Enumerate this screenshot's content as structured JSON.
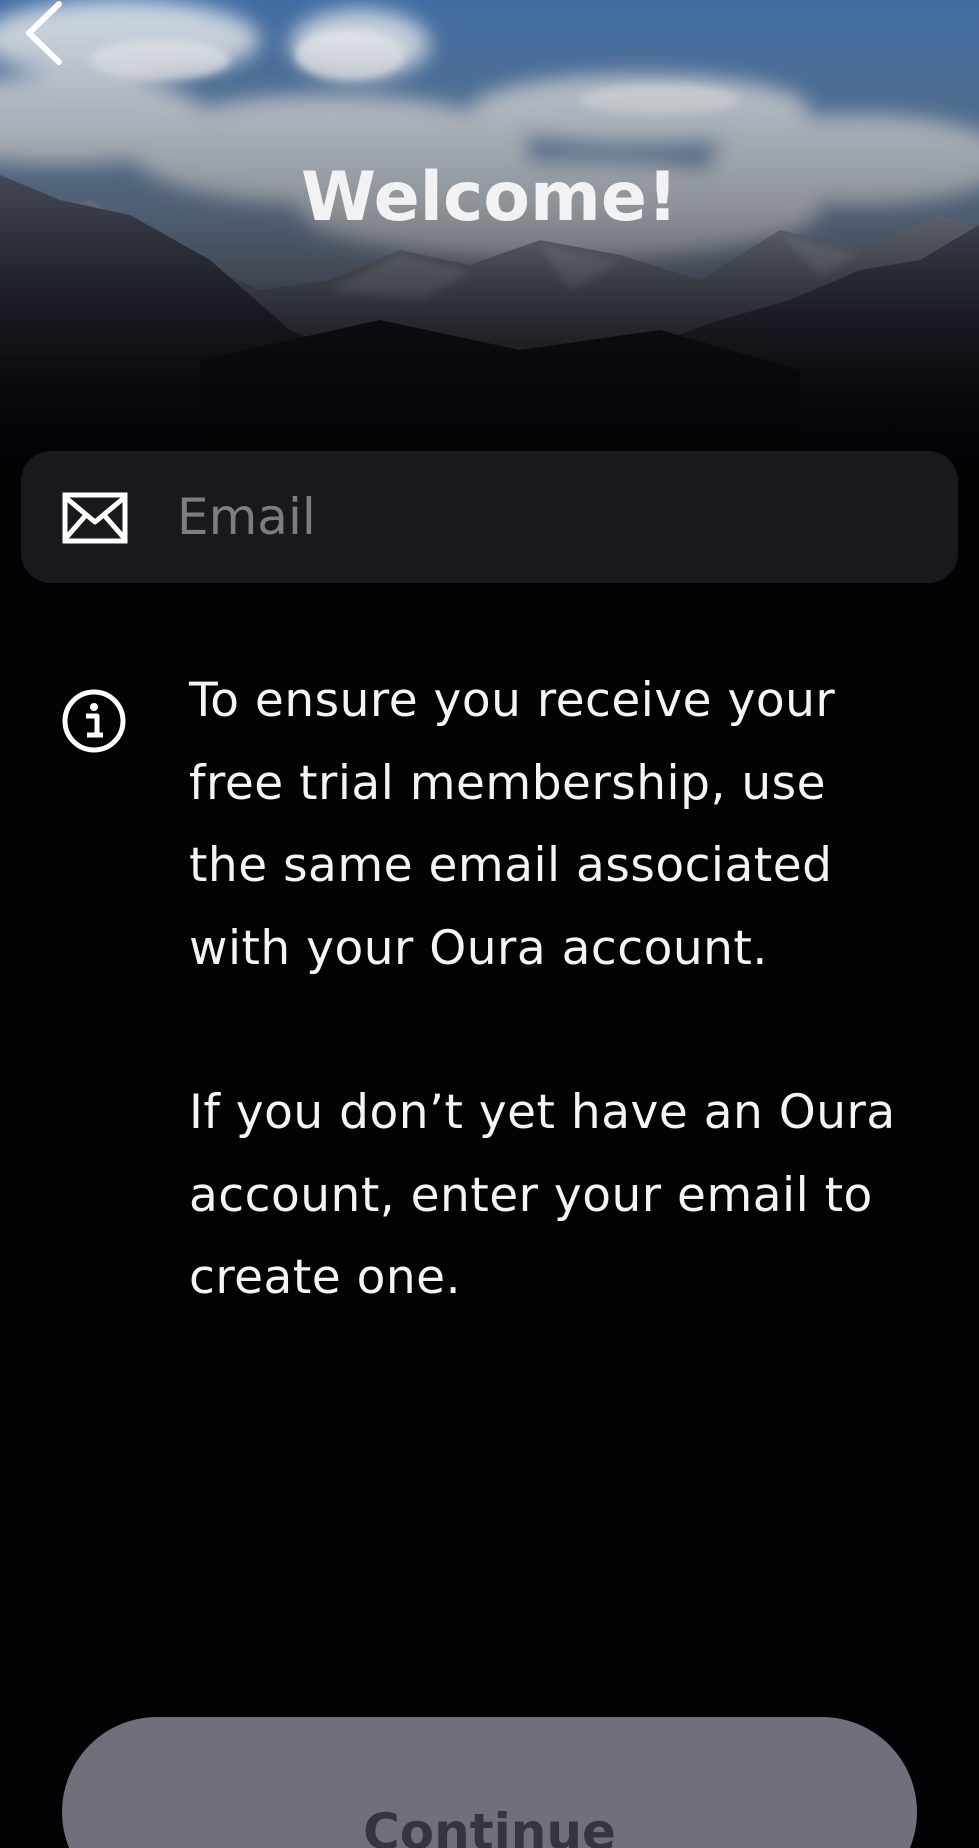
{
  "header": {
    "title": "Welcome!",
    "back_icon": "chevron-left-icon"
  },
  "email": {
    "icon": "envelope-icon",
    "placeholder": "Email",
    "value": ""
  },
  "info": {
    "icon": "info-circle-icon",
    "paragraph_1": "To ensure you receive your\nfree trial membership, use\nthe same email associated\nwith your Oura account.",
    "paragraph_2": "If you don’t yet have an Oura\naccount, enter your email to\ncreate one."
  },
  "footer": {
    "continue_label": "Continue"
  },
  "colors": {
    "background": "#030205",
    "field_background": "#19181d",
    "button_disabled": "#6f7079",
    "button_text_disabled": "#35363d",
    "text_primary": "#f4f4f6",
    "placeholder": "#7d7c82"
  }
}
